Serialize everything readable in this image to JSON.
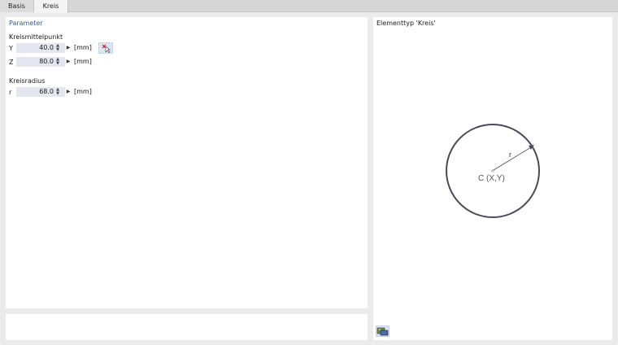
{
  "tabs": [
    {
      "label": "Basis"
    },
    {
      "label": "Kreis"
    }
  ],
  "parameters": {
    "header": "Parameter",
    "center_section": "Kreismittelpunkt",
    "y": {
      "label": "Y",
      "value": "40.0",
      "unit": "[mm]"
    },
    "z": {
      "label": "Z",
      "value": "80.0",
      "unit": "[mm]"
    },
    "radius_section": "Kreisradius",
    "r": {
      "label": "r",
      "value": "68.0",
      "unit": "[mm]"
    }
  },
  "preview": {
    "header": "Elementtyp 'Kreis'",
    "radius_label": "r",
    "center_label": "C (X,Y)"
  },
  "icons": {
    "pick": "pick-point-icon",
    "image": "image-icon",
    "spin": "spin-arrows-icon",
    "next": "arrow-right-icon"
  }
}
